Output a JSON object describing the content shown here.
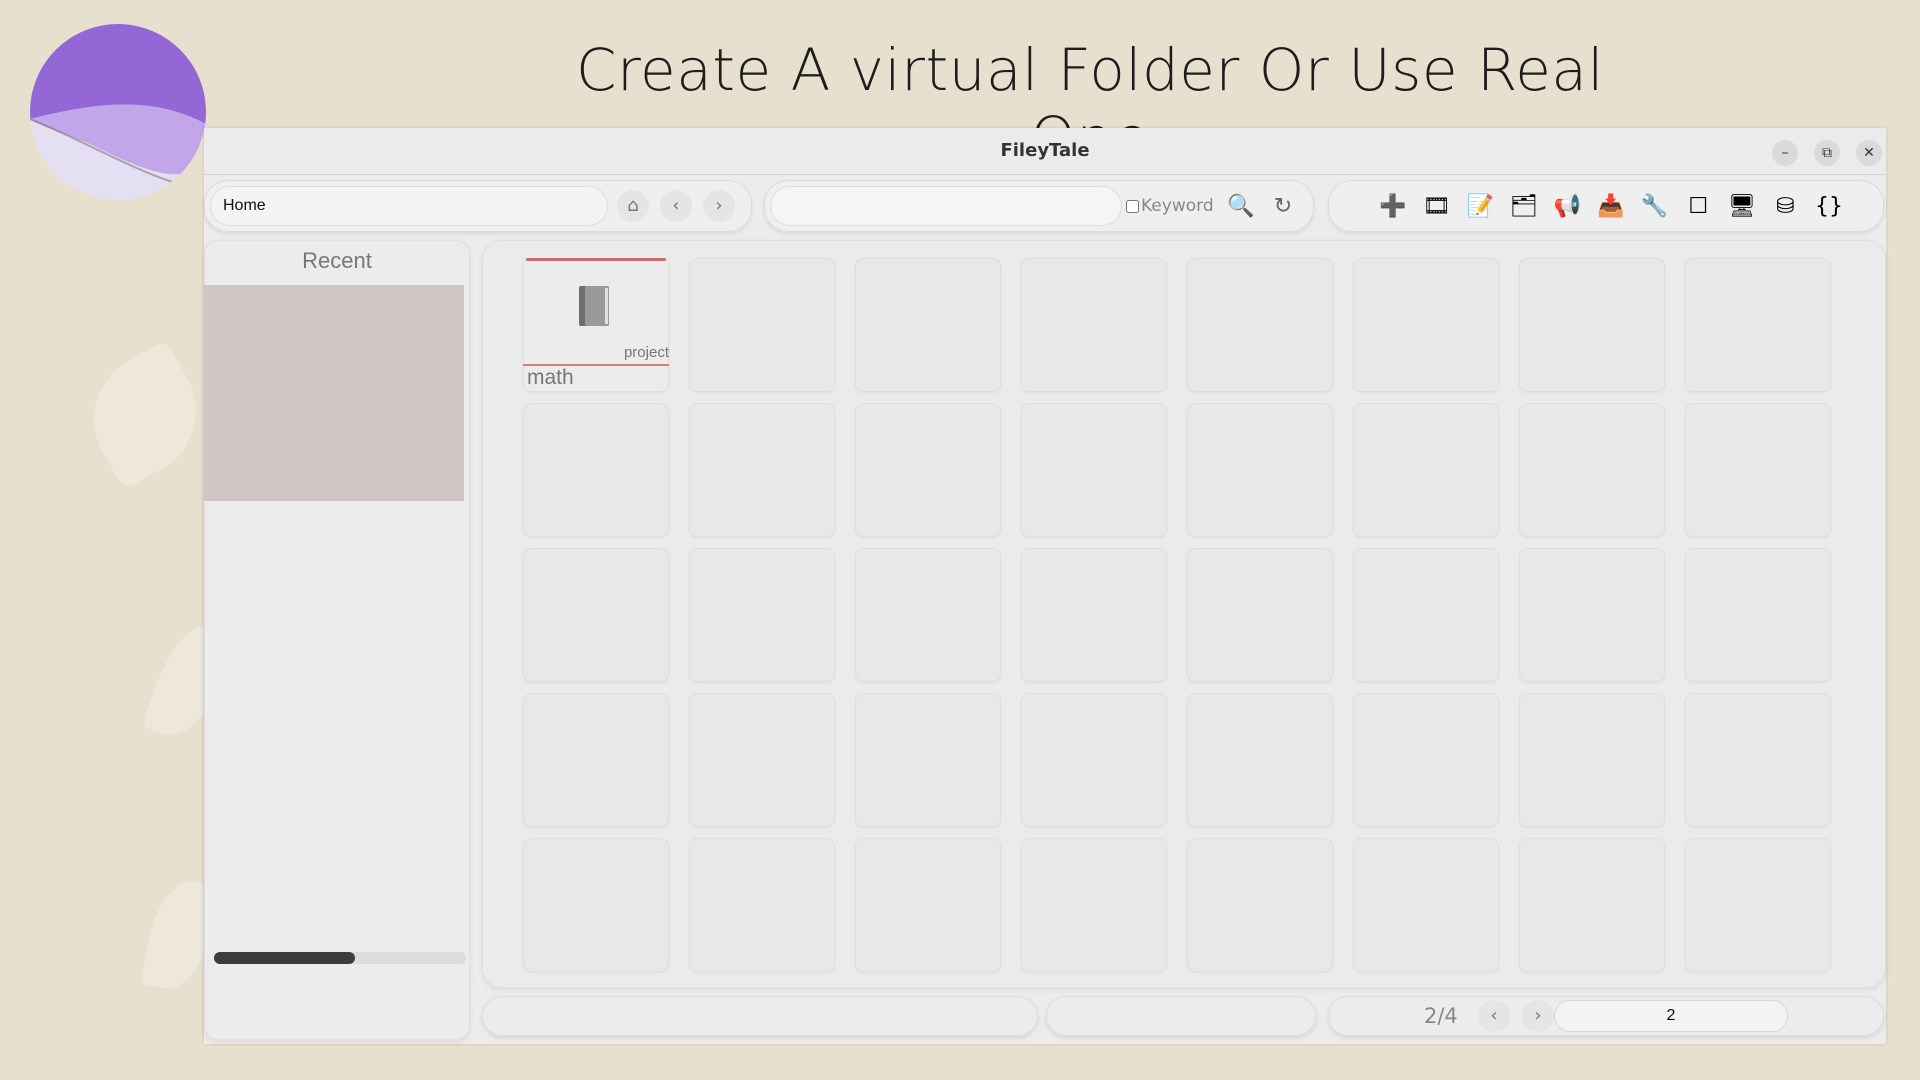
{
  "slide": {
    "title": "Create A virtual Folder Or Use Real One"
  },
  "window": {
    "title": "FileyTale",
    "controls": {
      "minimize": "–",
      "restore": "⧉",
      "close": "✕"
    }
  },
  "toolbar": {
    "path_value": "Home",
    "search_value": "",
    "keyword_label": "Keyword",
    "keyword_checked": false,
    "nav_icons": {
      "home": "⌂",
      "back": "‹",
      "forward": "›"
    },
    "search_icon": "🔍",
    "refresh_icon": "↻",
    "tools": [
      {
        "name": "add-icon",
        "glyph": "➕"
      },
      {
        "name": "film-icon",
        "glyph": "🎞"
      },
      {
        "name": "note-icon",
        "glyph": "📝"
      },
      {
        "name": "folder-icon",
        "glyph": "🗂"
      },
      {
        "name": "megaphone-icon",
        "glyph": "📢"
      },
      {
        "name": "inbox-icon",
        "glyph": "📥"
      },
      {
        "name": "wrench-icon",
        "glyph": "🔧"
      },
      {
        "name": "square-icon",
        "glyph": "☐"
      },
      {
        "name": "monitor-icon",
        "glyph": "🖥"
      },
      {
        "name": "database-icon",
        "glyph": "⛁"
      },
      {
        "name": "braces-icon",
        "glyph": "{}"
      }
    ]
  },
  "sidebar": {
    "recent_title": "Recent",
    "progress_fraction": 0.56
  },
  "grid": {
    "columns": 8,
    "rows": 5,
    "items": [
      {
        "name": "math",
        "tag": "project",
        "icon": "book-icon"
      }
    ]
  },
  "pagination": {
    "page_count": "2/4",
    "prev": "‹",
    "next": "›",
    "page_value": "2"
  }
}
